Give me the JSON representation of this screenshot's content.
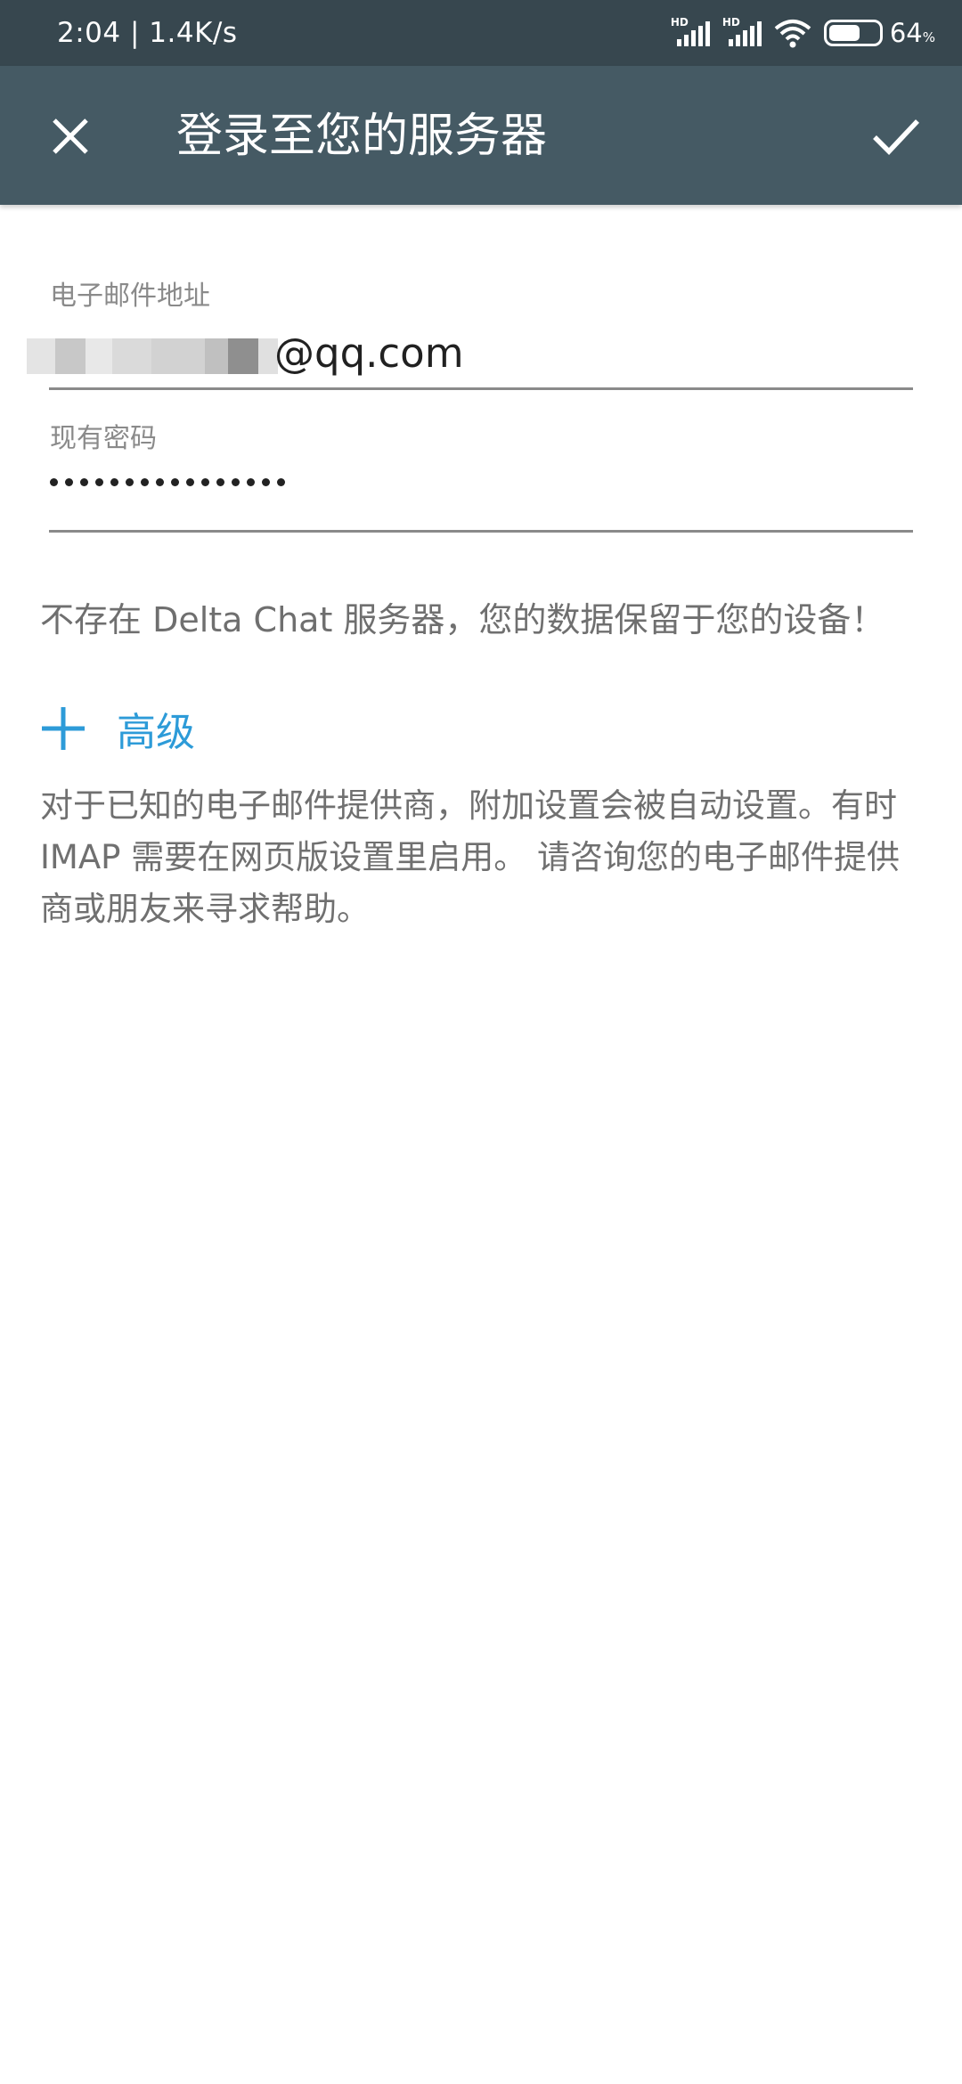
{
  "status_bar": {
    "time": "2:04 | 1.4K/s",
    "signal_1_label": "HD",
    "signal_2_label": "HD",
    "battery_percent": "64",
    "battery_unit": "%"
  },
  "toolbar": {
    "title": "登录至您的服务器",
    "close_icon": "close-icon",
    "confirm_icon": "check-icon"
  },
  "form": {
    "email_label": "电子邮件地址",
    "email_value_suffix": "@qq.com",
    "password_label": "现有密码",
    "password_mask": "••••••••••••••••"
  },
  "info_text": "不存在 Delta Chat 服务器，您的数据保留于您的设备！",
  "advanced_label": "高级",
  "description": "对于已知的电子邮件提供商，附加设置会被自动设置。有时 IMAP 需要在网页版设置里启用。 请咨询您的电子邮件提供商或朋友来寻求帮助。",
  "colors": {
    "status_bar_bg": "#37474f",
    "toolbar_bg": "#455a64",
    "accent": "#2d9bd8",
    "battery_level": 0.64
  }
}
